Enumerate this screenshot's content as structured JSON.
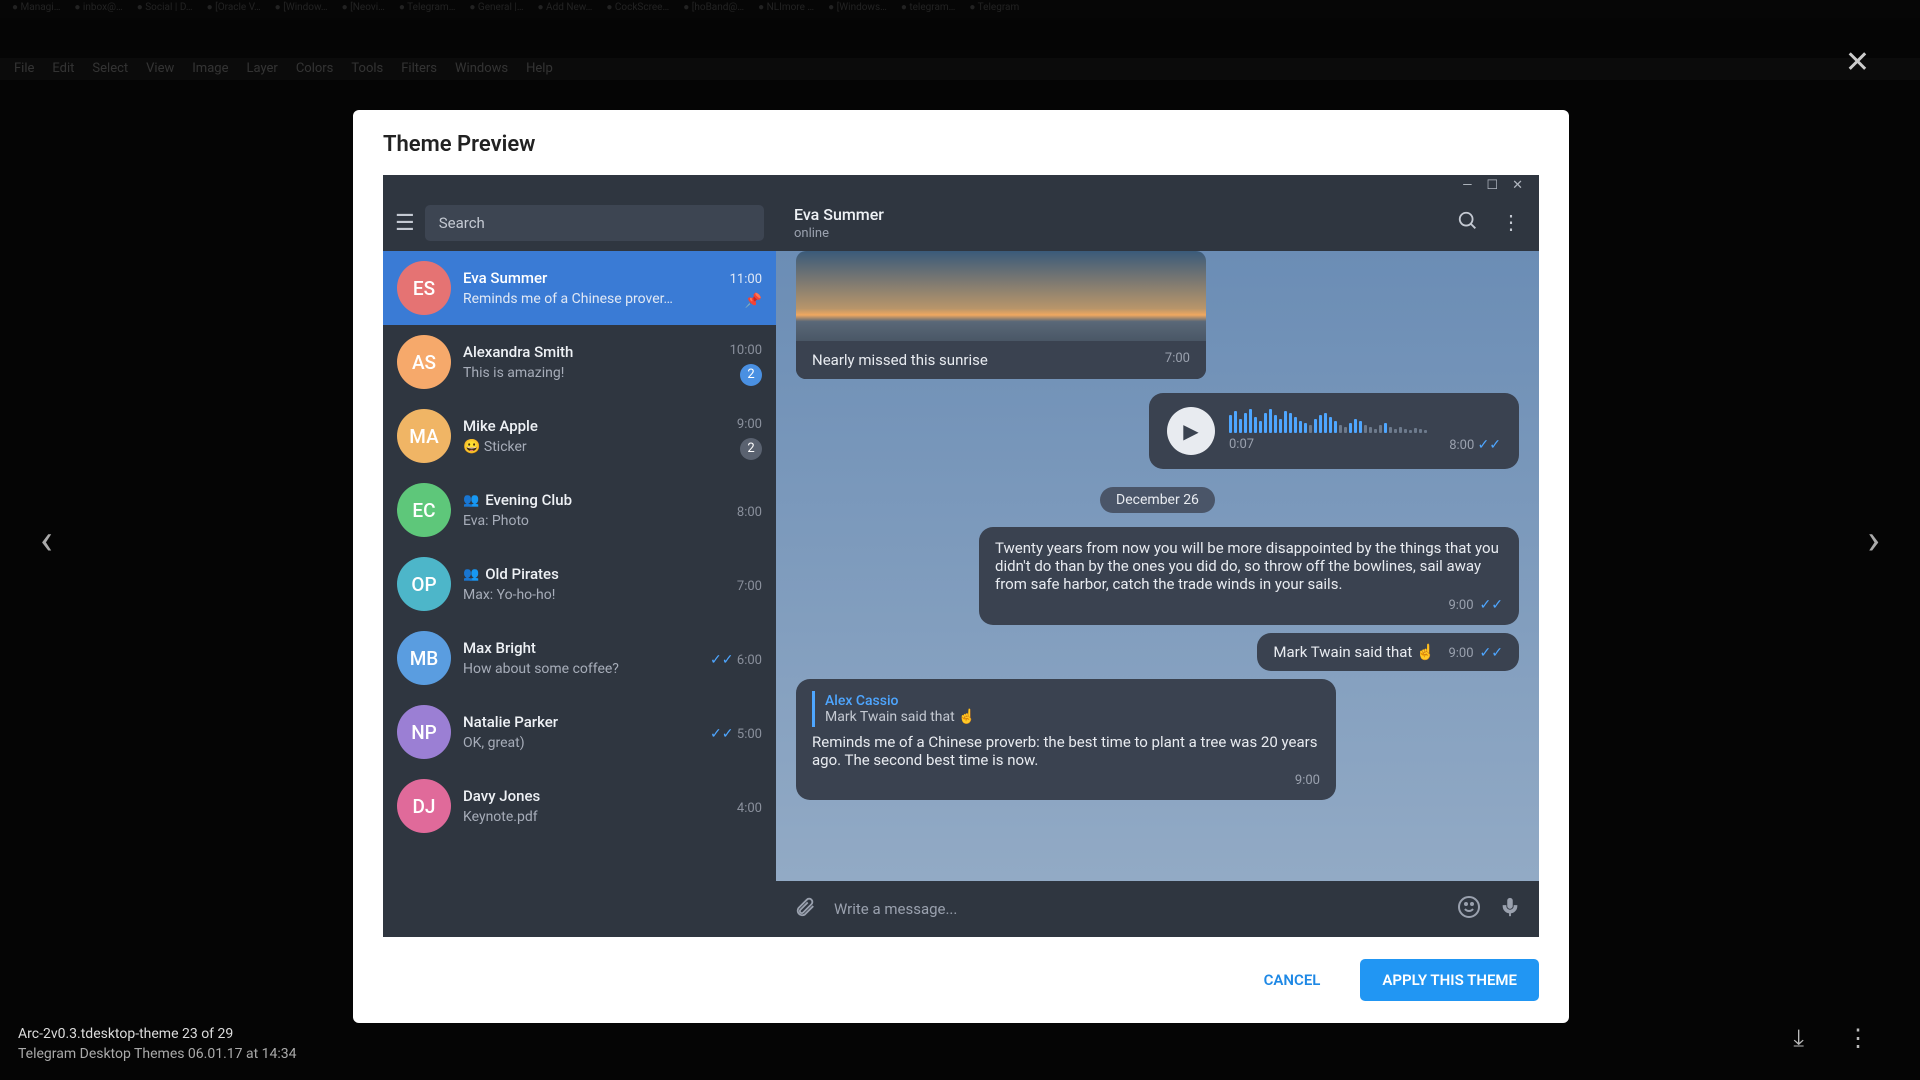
{
  "tabs": [
    "Managi…",
    "inbox@…",
    "Social | D…",
    "[Oracle V…",
    "[Window…",
    "[Neovi…",
    "Telegram…",
    "General |…",
    "Add New…",
    "CockScree…",
    "[hoBand@…",
    "NLImore …",
    "[Windows…",
    "telegram…",
    "Telegram"
  ],
  "menu": [
    "File",
    "Edit",
    "Select",
    "View",
    "Image",
    "Layer",
    "Colors",
    "Tools",
    "Filters",
    "Windows",
    "Help"
  ],
  "modal": {
    "title": "Theme Preview",
    "cancel": "CANCEL",
    "apply": "APPLY THIS THEME"
  },
  "search_placeholder": "Search",
  "header": {
    "name": "Eva Summer",
    "status": "online"
  },
  "chats": [
    {
      "initials": "ES",
      "color": "#e57373",
      "name": "Eva Summer",
      "preview": "Reminds me of a Chinese prover…",
      "time": "11:00",
      "active": true,
      "pinned": true
    },
    {
      "initials": "AS",
      "color": "#f6a96b",
      "name": "Alexandra Smith",
      "preview": "This is amazing!",
      "time": "10:00",
      "badge": "2",
      "badge_blue": true
    },
    {
      "initials": "MA",
      "color": "#f0b565",
      "name": "Mike Apple",
      "preview": "😀 Sticker",
      "time": "9:00",
      "badge": "2"
    },
    {
      "initials": "EC",
      "color": "#5ec77a",
      "name": "Evening Club",
      "preview": "Eva: Photo",
      "time": "8:00",
      "group": true
    },
    {
      "initials": "OP",
      "color": "#4db6c9",
      "name": "Old Pirates",
      "preview": "Max: Yo-ho-ho!",
      "time": "7:00",
      "group": true
    },
    {
      "initials": "MB",
      "color": "#5a9de0",
      "name": "Max Bright",
      "preview": "How about some coffee?",
      "time": "6:00",
      "checks": true
    },
    {
      "initials": "NP",
      "color": "#9b7fd4",
      "name": "Natalie Parker",
      "preview": "OK, great)",
      "time": "5:00",
      "checks": true
    },
    {
      "initials": "DJ",
      "color": "#e06a9a",
      "name": "Davy Jones",
      "preview": "Keynote.pdf",
      "time": "4:00"
    }
  ],
  "date_pill": "December 26",
  "img_caption": "Nearly missed this sunrise",
  "img_time": "7:00",
  "voice_duration": "0:07",
  "voice_time": "8:00",
  "msg_quote": "Twenty years from now you will be more disappointed by the things that you didn't do than by the ones you did do, so throw off the bowlines, sail away from safe harbor, catch the trade winds in your sails.",
  "msg_quote_time": "9:00",
  "msg_twain": "Mark Twain said that ☝️",
  "msg_twain_time": "9:00",
  "reply": {
    "name": "Alex Cassio",
    "quote": "Mark Twain said that ☝️",
    "text": "Reminds me of a Chinese proverb: the best time to plant a tree was 20 years ago. The second best time is now.",
    "time": "9:00"
  },
  "input_placeholder": "Write a message...",
  "viewer": {
    "line1": "Arc-2v0.3.tdesktop-theme 23 of 29",
    "line2": "Telegram Desktop Themes   06.01.17 at 14:34"
  }
}
